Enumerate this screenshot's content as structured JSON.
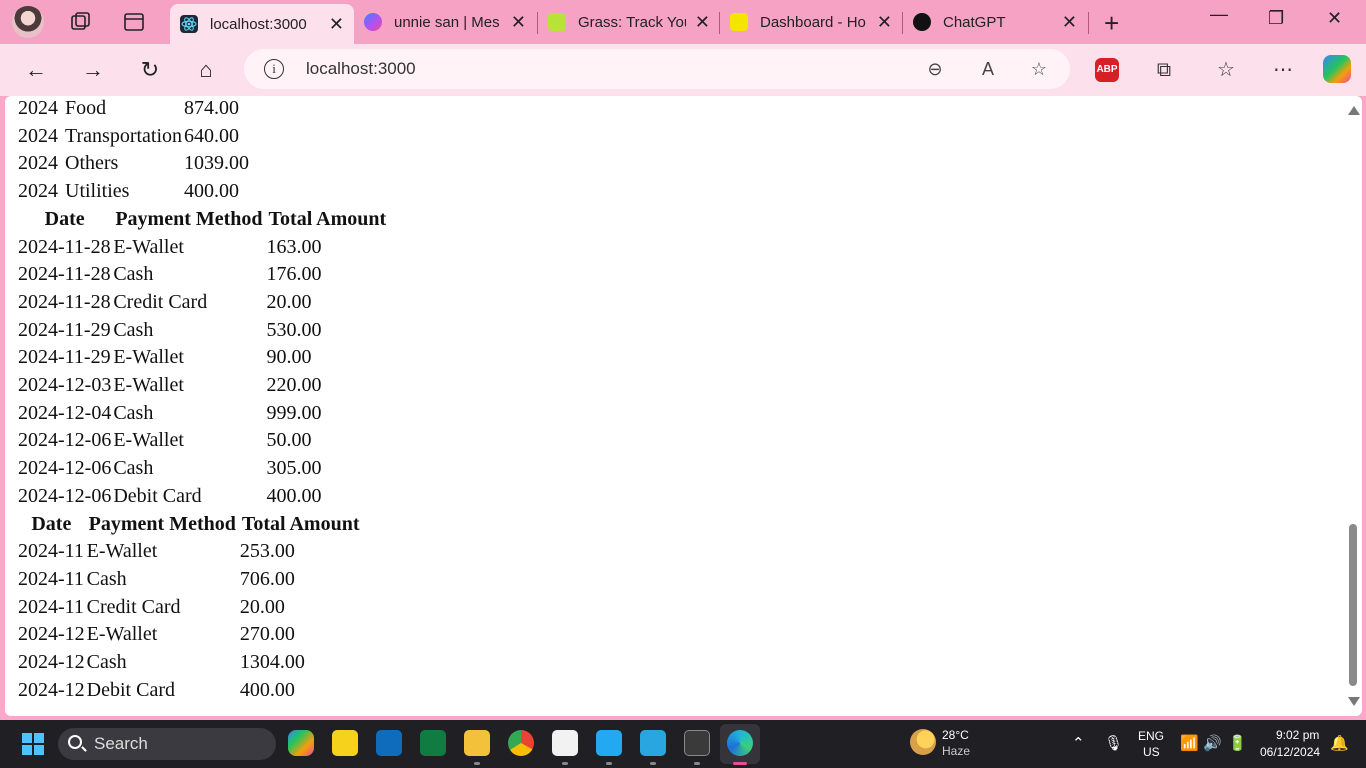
{
  "browser": {
    "tabs": [
      {
        "title": "localhost:3000",
        "favicon": "react-icon",
        "color": "#1f2937",
        "active": true
      },
      {
        "title": "unnie san | Mes",
        "favicon": "messenger-icon",
        "color": "#a855f7",
        "active": false
      },
      {
        "title": "Grass: Track You",
        "favicon": "grass-icon",
        "color": "#b6e23a",
        "active": false
      },
      {
        "title": "Dashboard - Ho",
        "favicon": "sti-icon",
        "color": "#f5e400",
        "active": false
      },
      {
        "title": "ChatGPT",
        "favicon": "chatgpt-icon",
        "color": "#111111",
        "active": false
      }
    ],
    "address": {
      "url": "localhost:3000"
    },
    "theme_color": "#f6a2c4"
  },
  "page": {
    "category_totals": [
      {
        "year": "2024",
        "category": "Food",
        "amount": "874.00"
      },
      {
        "year": "2024",
        "category": "Transportation",
        "amount": "640.00"
      },
      {
        "year": "2024",
        "category": "Others",
        "amount": "1039.00"
      },
      {
        "year": "2024",
        "category": "Utilities",
        "amount": "400.00"
      }
    ],
    "daily_headers": [
      "Date",
      "Payment Method",
      "Total Amount"
    ],
    "daily": [
      {
        "date": "2024-11-28",
        "method": "E-Wallet",
        "amount": "163.00"
      },
      {
        "date": "2024-11-28",
        "method": "Cash",
        "amount": "176.00"
      },
      {
        "date": "2024-11-28",
        "method": "Credit Card",
        "amount": "20.00"
      },
      {
        "date": "2024-11-29",
        "method": "Cash",
        "amount": "530.00"
      },
      {
        "date": "2024-11-29",
        "method": "E-Wallet",
        "amount": "90.00"
      },
      {
        "date": "2024-12-03",
        "method": "E-Wallet",
        "amount": "220.00"
      },
      {
        "date": "2024-12-04",
        "method": "Cash",
        "amount": "999.00"
      },
      {
        "date": "2024-12-06",
        "method": "E-Wallet",
        "amount": "50.00"
      },
      {
        "date": "2024-12-06",
        "method": "Cash",
        "amount": "305.00"
      },
      {
        "date": "2024-12-06",
        "method": "Debit Card",
        "amount": "400.00"
      }
    ],
    "monthly_headers": [
      "Date",
      "Payment Method",
      "Total Amount"
    ],
    "monthly": [
      {
        "date": "2024-11",
        "method": "E-Wallet",
        "amount": "253.00"
      },
      {
        "date": "2024-11",
        "method": "Cash",
        "amount": "706.00"
      },
      {
        "date": "2024-11",
        "method": "Credit Card",
        "amount": "20.00"
      },
      {
        "date": "2024-12",
        "method": "E-Wallet",
        "amount": "270.00"
      },
      {
        "date": "2024-12",
        "method": "Cash",
        "amount": "1304.00"
      },
      {
        "date": "2024-12",
        "method": "Debit Card",
        "amount": "400.00"
      }
    ]
  },
  "taskbar": {
    "search_label": "Search",
    "weather_temp": "28°C",
    "weather_desc": "Haze",
    "lang_top": "ENG",
    "lang_bottom": "US",
    "time": "9:02 pm",
    "date": "06/12/2024"
  }
}
